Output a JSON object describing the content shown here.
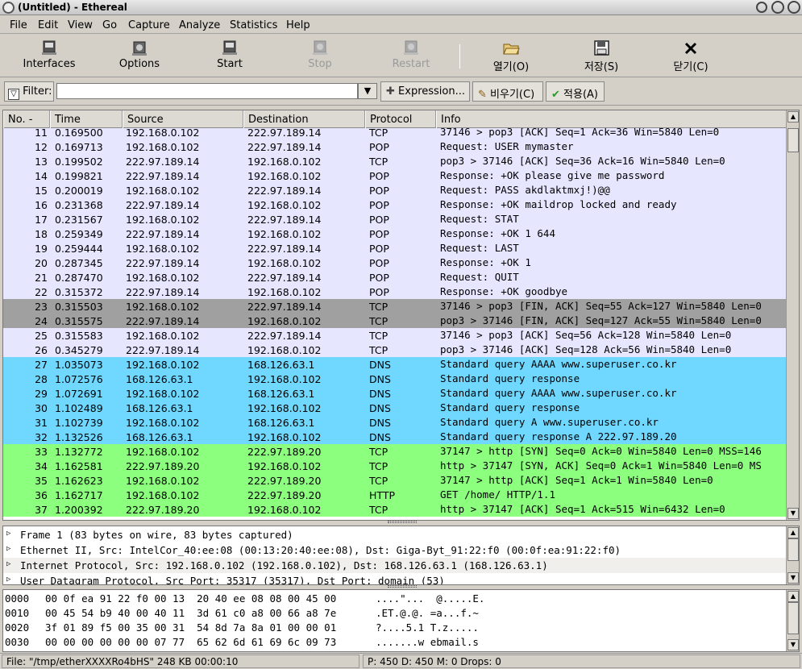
{
  "window": {
    "title": "(Untitled) - Ethereal"
  },
  "menu": [
    "File",
    "Edit",
    "View",
    "Go",
    "Capture",
    "Analyze",
    "Statistics",
    "Help"
  ],
  "toolbar": {
    "interfaces": "Interfaces",
    "options": "Options",
    "start": "Start",
    "stop": "Stop",
    "restart": "Restart",
    "open": "열기(O)",
    "save": "저장(S)",
    "close": "닫기(C)"
  },
  "filterbar": {
    "label": "Filter:",
    "value": "",
    "expression": "Expression...",
    "clear": "비우기(C)",
    "apply": "적용(A)"
  },
  "packet_list": {
    "columns": [
      "No. -",
      "Time",
      "Source",
      "Destination",
      "Protocol",
      "Info"
    ],
    "colors": {
      "tcp": "#e7e6ff",
      "pop": "#e7e6ff",
      "fin": "#a0a0a0",
      "dns": "#70d8ff",
      "http": "#8dff7f"
    },
    "rows": [
      {
        "no": "11",
        "time": "0.169500",
        "src": "192.168.0.102",
        "dst": "222.97.189.14",
        "proto": "TCP",
        "info": "37146 > pop3 [ACK] Seq=1 Ack=36 Win=5840 Len=0",
        "color": "tcp"
      },
      {
        "no": "12",
        "time": "0.169713",
        "src": "192.168.0.102",
        "dst": "222.97.189.14",
        "proto": "POP",
        "info": "Request: USER mymaster",
        "color": "pop"
      },
      {
        "no": "13",
        "time": "0.199502",
        "src": "222.97.189.14",
        "dst": "192.168.0.102",
        "proto": "TCP",
        "info": "pop3 > 37146 [ACK] Seq=36 Ack=16 Win=5840 Len=0",
        "color": "tcp"
      },
      {
        "no": "14",
        "time": "0.199821",
        "src": "222.97.189.14",
        "dst": "192.168.0.102",
        "proto": "POP",
        "info": "Response: +OK please give me password",
        "color": "pop"
      },
      {
        "no": "15",
        "time": "0.200019",
        "src": "192.168.0.102",
        "dst": "222.97.189.14",
        "proto": "POP",
        "info": "Request: PASS akdlaktmxj!)@@",
        "color": "pop"
      },
      {
        "no": "16",
        "time": "0.231368",
        "src": "222.97.189.14",
        "dst": "192.168.0.102",
        "proto": "POP",
        "info": "Response: +OK maildrop locked and ready",
        "color": "pop"
      },
      {
        "no": "17",
        "time": "0.231567",
        "src": "192.168.0.102",
        "dst": "222.97.189.14",
        "proto": "POP",
        "info": "Request: STAT",
        "color": "pop"
      },
      {
        "no": "18",
        "time": "0.259349",
        "src": "222.97.189.14",
        "dst": "192.168.0.102",
        "proto": "POP",
        "info": "Response: +OK 1 644",
        "color": "pop"
      },
      {
        "no": "19",
        "time": "0.259444",
        "src": "192.168.0.102",
        "dst": "222.97.189.14",
        "proto": "POP",
        "info": "Request: LAST",
        "color": "pop"
      },
      {
        "no": "20",
        "time": "0.287345",
        "src": "222.97.189.14",
        "dst": "192.168.0.102",
        "proto": "POP",
        "info": "Response: +OK 1",
        "color": "pop"
      },
      {
        "no": "21",
        "time": "0.287470",
        "src": "192.168.0.102",
        "dst": "222.97.189.14",
        "proto": "POP",
        "info": "Request: QUIT",
        "color": "pop"
      },
      {
        "no": "22",
        "time": "0.315372",
        "src": "222.97.189.14",
        "dst": "192.168.0.102",
        "proto": "POP",
        "info": "Response: +OK goodbye",
        "color": "pop"
      },
      {
        "no": "23",
        "time": "0.315503",
        "src": "192.168.0.102",
        "dst": "222.97.189.14",
        "proto": "TCP",
        "info": "37146 > pop3 [FIN, ACK] Seq=55 Ack=127 Win=5840 Len=0",
        "color": "fin"
      },
      {
        "no": "24",
        "time": "0.315575",
        "src": "222.97.189.14",
        "dst": "192.168.0.102",
        "proto": "TCP",
        "info": "pop3 > 37146 [FIN, ACK] Seq=127 Ack=55 Win=5840 Len=0",
        "color": "fin"
      },
      {
        "no": "25",
        "time": "0.315583",
        "src": "192.168.0.102",
        "dst": "222.97.189.14",
        "proto": "TCP",
        "info": "37146 > pop3 [ACK] Seq=56 Ack=128 Win=5840 Len=0",
        "color": "tcp"
      },
      {
        "no": "26",
        "time": "0.345279",
        "src": "222.97.189.14",
        "dst": "192.168.0.102",
        "proto": "TCP",
        "info": "pop3 > 37146 [ACK] Seq=128 Ack=56 Win=5840 Len=0",
        "color": "tcp"
      },
      {
        "no": "27",
        "time": "1.035073",
        "src": "192.168.0.102",
        "dst": "168.126.63.1",
        "proto": "DNS",
        "info": "Standard query AAAA www.superuser.co.kr",
        "color": "dns"
      },
      {
        "no": "28",
        "time": "1.072576",
        "src": "168.126.63.1",
        "dst": "192.168.0.102",
        "proto": "DNS",
        "info": "Standard query response",
        "color": "dns"
      },
      {
        "no": "29",
        "time": "1.072691",
        "src": "192.168.0.102",
        "dst": "168.126.63.1",
        "proto": "DNS",
        "info": "Standard query AAAA www.superuser.co.kr",
        "color": "dns"
      },
      {
        "no": "30",
        "time": "1.102489",
        "src": "168.126.63.1",
        "dst": "192.168.0.102",
        "proto": "DNS",
        "info": "Standard query response",
        "color": "dns"
      },
      {
        "no": "31",
        "time": "1.102739",
        "src": "192.168.0.102",
        "dst": "168.126.63.1",
        "proto": "DNS",
        "info": "Standard query A www.superuser.co.kr",
        "color": "dns"
      },
      {
        "no": "32",
        "time": "1.132526",
        "src": "168.126.63.1",
        "dst": "192.168.0.102",
        "proto": "DNS",
        "info": "Standard query response A 222.97.189.20",
        "color": "dns"
      },
      {
        "no": "33",
        "time": "1.132772",
        "src": "192.168.0.102",
        "dst": "222.97.189.20",
        "proto": "TCP",
        "info": "37147 > http [SYN] Seq=0 Ack=0 Win=5840 Len=0 MSS=146",
        "color": "http"
      },
      {
        "no": "34",
        "time": "1.162581",
        "src": "222.97.189.20",
        "dst": "192.168.0.102",
        "proto": "TCP",
        "info": "http > 37147 [SYN, ACK] Seq=0 Ack=1 Win=5840 Len=0 MS",
        "color": "http"
      },
      {
        "no": "35",
        "time": "1.162623",
        "src": "192.168.0.102",
        "dst": "222.97.189.20",
        "proto": "TCP",
        "info": "37147 > http [ACK] Seq=1 Ack=1 Win=5840 Len=0",
        "color": "http"
      },
      {
        "no": "36",
        "time": "1.162717",
        "src": "192.168.0.102",
        "dst": "222.97.189.20",
        "proto": "HTTP",
        "info": "GET /home/ HTTP/1.1",
        "color": "http"
      },
      {
        "no": "37",
        "time": "1.200392",
        "src": "222.97.189.20",
        "dst": "192.168.0.102",
        "proto": "TCP",
        "info": "http > 37147 [ACK] Seq=1 Ack=515 Win=6432 Len=0",
        "color": "http"
      }
    ]
  },
  "details": [
    "Frame 1 (83 bytes on wire, 83 bytes captured)",
    "Ethernet II, Src: IntelCor_40:ee:08 (00:13:20:40:ee:08), Dst: Giga-Byt_91:22:f0 (00:0f:ea:91:22:f0)",
    "Internet Protocol, Src: 192.168.0.102 (192.168.0.102), Dst: 168.126.63.1 (168.126.63.1)",
    "User Datagram Protocol, Src Port: 35317 (35317), Dst Port: domain (53)"
  ],
  "bytes": [
    {
      "offset": "0000",
      "hex": "00 0f ea 91 22 f0 00 13  20 40 ee 08 08 00 45 00",
      "ascii": "....\"...  @.....E."
    },
    {
      "offset": "0010",
      "hex": "00 45 54 b9 40 00 40 11  3d 61 c0 a8 00 66 a8 7e",
      "ascii": ".ET.@.@. =a...f.~"
    },
    {
      "offset": "0020",
      "hex": "3f 01 89 f5 00 35 00 31  54 8d 7a 8a 01 00 00 01",
      "ascii": "?....5.1 T.z....."
    },
    {
      "offset": "0030",
      "hex": "00 00 00 00 00 00 07 77  65 62 6d 61 69 6c 09 73",
      "ascii": ".......w ebmail.s"
    }
  ],
  "status": {
    "file": "File: \"/tmp/etherXXXXRo4bHS\" 248 KB 00:00:10",
    "packets": "P: 450 D: 450 M: 0 Drops: 0"
  }
}
